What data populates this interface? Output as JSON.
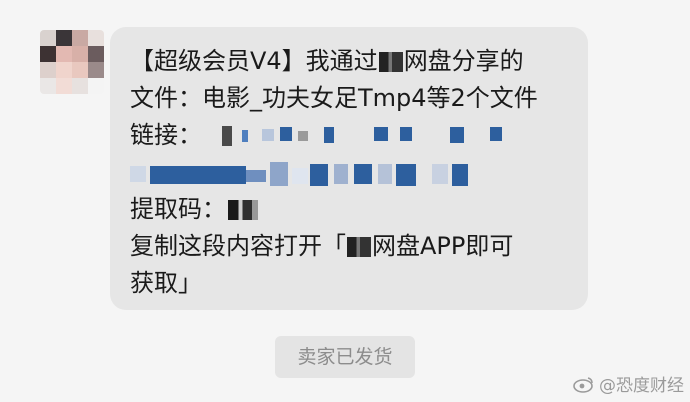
{
  "message": {
    "line1": "【超级会员V4】我通过",
    "line1_tail": "网盘分享的",
    "line2": "文件：电影_功夫女足Tmp4等2个文件",
    "link_label": "链接：",
    "code_label": "提取码：",
    "line_open": "复制这段内容打开「",
    "line_open_tail": "网盘APP即可",
    "line_last": "获取」"
  },
  "status_chip": "卖家已发货",
  "watermark": "@恐度财经",
  "colors": {
    "background": "#f5f5f5",
    "bubble": "#e6e6e6",
    "chip": "#e4e4e4",
    "mosaic_blue": "#2d5f9e"
  }
}
